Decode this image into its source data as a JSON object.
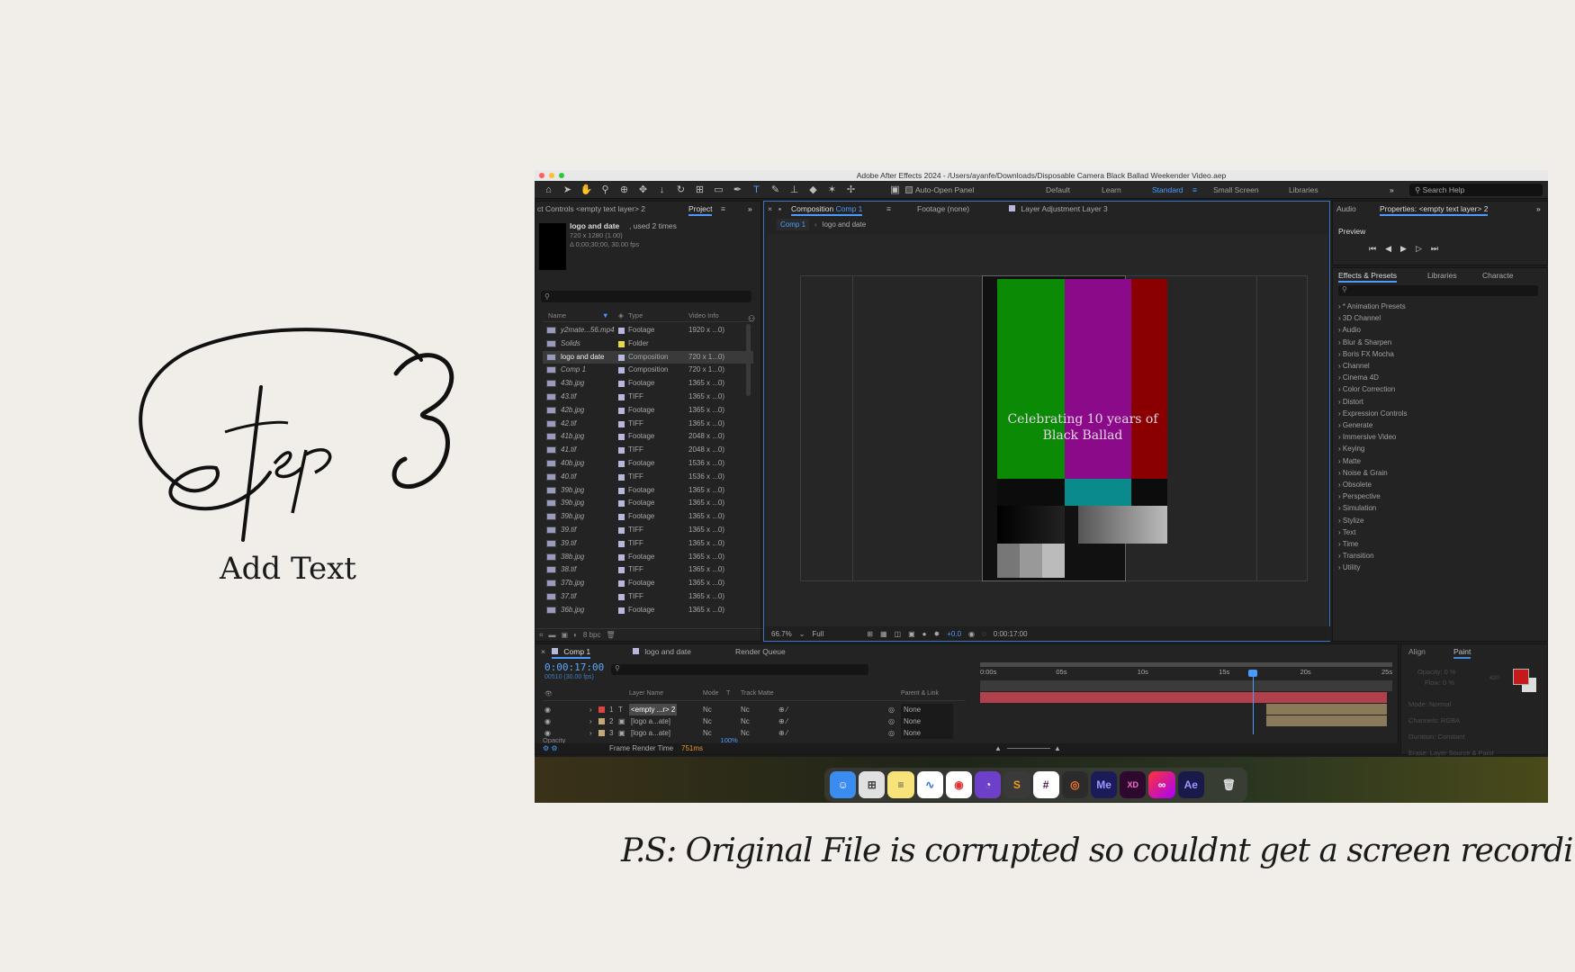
{
  "slide": {
    "step_label": "Step 3",
    "subtitle": "Add Text",
    "ps_note": "P.S: Original File is corrupted so couldnt get a screen recording :("
  },
  "app": {
    "title": "Adobe After Effects 2024 - /Users/ayanfe/Downloads/Disposable Camera Black Ballad Weekender Video.aep",
    "auto_open_panel": "Auto-Open Panel",
    "workspaces": [
      "Default",
      "Learn",
      "Standard",
      "Small Screen",
      "Libraries"
    ],
    "active_workspace": "Standard",
    "search_help": "Search Help",
    "tools": [
      "home-icon",
      "selection-tool-icon",
      "hand-tool-icon",
      "zoom-tool-icon",
      "orbit-icon",
      "pan-icon",
      "dolly-icon",
      "rotate-icon",
      "anchor-icon",
      "rectangle-tool-icon",
      "pen-tool-icon",
      "type-tool-icon",
      "brush-tool-icon",
      "clone-stamp-icon",
      "eraser-icon",
      "roto-brush-icon",
      "puppet-pin-icon"
    ]
  },
  "left_panel": {
    "effects_tab": "ct Controls <empty text layer> 2",
    "project_tab": "Project",
    "item_name": "logo and date",
    "item_used": ", used 2 times",
    "item_size": "720 x 1280 (1.00)",
    "item_duration": "Δ 0;00;30;00, 30.00 fps",
    "columns": [
      "Name",
      "Type",
      "Video Info"
    ],
    "bpc": "8 bpc",
    "items": [
      {
        "name": "y2mate...56.mp4",
        "type": "Footage",
        "info": "1920 x ...0)",
        "label": "#b8b8dc"
      },
      {
        "name": "Solids",
        "type": "Folder",
        "info": "",
        "label": "#e8d84a"
      },
      {
        "name": "logo and date",
        "type": "Composition",
        "info": "720 x 1...0)",
        "label": "#b8b8dc"
      },
      {
        "name": "Comp 1",
        "type": "Composition",
        "info": "720 x 1...0)",
        "label": "#b8b8dc"
      },
      {
        "name": "43b.jpg",
        "type": "Footage",
        "info": "1365 x ...0)",
        "label": "#b8b8dc"
      },
      {
        "name": "43.tif",
        "type": "TIFF",
        "info": "1365 x ...0)",
        "label": "#b8b8dc"
      },
      {
        "name": "42b.jpg",
        "type": "Footage",
        "info": "1365 x ...0)",
        "label": "#b8b8dc"
      },
      {
        "name": "42.tif",
        "type": "TIFF",
        "info": "1365 x ...0)",
        "label": "#b8b8dc"
      },
      {
        "name": "41b.jpg",
        "type": "Footage",
        "info": "2048 x ...0)",
        "label": "#b8b8dc"
      },
      {
        "name": "41.tif",
        "type": "TIFF",
        "info": "2048 x ...0)",
        "label": "#b8b8dc"
      },
      {
        "name": "40b.jpg",
        "type": "Footage",
        "info": "1536 x ...0)",
        "label": "#b8b8dc"
      },
      {
        "name": "40.tif",
        "type": "TIFF",
        "info": "1536 x ...0)",
        "label": "#b8b8dc"
      },
      {
        "name": "39b.jpg",
        "type": "Footage",
        "info": "1365 x ...0)",
        "label": "#b8b8dc"
      },
      {
        "name": "39b.jpg",
        "type": "Footage",
        "info": "1365 x ...0)",
        "label": "#b8b8dc"
      },
      {
        "name": "39b.jpg",
        "type": "Footage",
        "info": "1365 x ...0)",
        "label": "#b8b8dc"
      },
      {
        "name": "39.tif",
        "type": "TIFF",
        "info": "1365 x ...0)",
        "label": "#b8b8dc"
      },
      {
        "name": "39.tif",
        "type": "TIFF",
        "info": "1365 x ...0)",
        "label": "#b8b8dc"
      },
      {
        "name": "38b.jpg",
        "type": "Footage",
        "info": "1365 x ...0)",
        "label": "#b8b8dc"
      },
      {
        "name": "38.tif",
        "type": "TIFF",
        "info": "1365 x ...0)",
        "label": "#b8b8dc"
      },
      {
        "name": "37b.jpg",
        "type": "Footage",
        "info": "1365 x ...0)",
        "label": "#b8b8dc"
      },
      {
        "name": "37.tif",
        "type": "TIFF",
        "info": "1365 x ...0)",
        "label": "#b8b8dc"
      },
      {
        "name": "36b.jpg",
        "type": "Footage",
        "info": "1365 x ...0)",
        "label": "#b8b8dc"
      }
    ]
  },
  "comp_panel": {
    "close": "×",
    "comp_tab_prefix": "Composition",
    "comp_tab_name": "Comp 1",
    "footage_tab": "Footage (none)",
    "layer_tab": "Layer Adjustment Layer 3",
    "crumb1": "Comp 1",
    "crumb2": "logo and date",
    "canvas_text_line1": "Celebrating 10 years of",
    "canvas_text_line2": "Black Ballad",
    "zoom": "66.7%",
    "resolution": "Full",
    "exposure": "+0.0",
    "timecode": "0:00:17:00"
  },
  "right_panel": {
    "audio_tab": "Audio",
    "properties_tab": "Properties: <empty text layer> 2",
    "preview": "Preview",
    "effects_tab": "Effects & Presets",
    "libraries_tab": "Libraries",
    "character_tab": "Characte",
    "categories": [
      "* Animation Presets",
      "3D Channel",
      "Audio",
      "Blur & Sharpen",
      "Boris FX Mocha",
      "Channel",
      "Cinema 4D",
      "Color Correction",
      "Distort",
      "Expression Controls",
      "Generate",
      "Immersive Video",
      "Keying",
      "Matte",
      "Noise & Grain",
      "Obsolete",
      "Perspective",
      "Simulation",
      "Stylize",
      "Text",
      "Time",
      "Transition",
      "Utility"
    ]
  },
  "timeline": {
    "comp_tab": "Comp 1",
    "logo_tab": "logo and date",
    "render_queue": "Render Queue",
    "timecode": "0:00:17:00",
    "frames": "00510 (30.00 fps)",
    "col_layer": "Layer Name",
    "col_mode": "Mode",
    "col_t": "T",
    "col_matte": "Track Matte",
    "col_parent": "Parent & Link",
    "ruler": [
      "0:00s",
      "05s",
      "10s",
      "15s",
      "20s",
      "25s"
    ],
    "layers": [
      {
        "num": "1",
        "name": "<empty ...r> 2",
        "mode": "Nc",
        "matte": "Nc",
        "parent": "None",
        "label": "#d44"
      },
      {
        "num": "2",
        "name": "[logo a...ate]",
        "mode": "Nc",
        "matte": "Nc",
        "parent": "None",
        "label": "#c4a978"
      },
      {
        "num": "3",
        "name": "[logo a...ate]",
        "mode": "Nc",
        "matte": "Nc",
        "parent": "None",
        "label": "#c4a978"
      }
    ],
    "partial_row": "Opacity",
    "partial_value": "100%",
    "frame_render_label": "Frame Render Time",
    "frame_render_value": "751ms"
  },
  "paint_panel": {
    "align_tab": "Align",
    "paint_tab": "Paint",
    "opacity": "Opacity: 0 %",
    "flow": "Flow: 0 %",
    "mode_label": "Mode:",
    "mode_value": "Normal",
    "channels_label": "Channels:",
    "channels_value": "RGBA",
    "duration_label": "Duration:",
    "duration_value": "Constant",
    "erase_label": "Erase:",
    "erase_value": "Layer Source & Paint",
    "brush_size": "420"
  },
  "dock": [
    "Finder",
    "Launchpad",
    "Notes",
    "Freeform",
    "Chrome",
    "GitHub",
    "Sublime",
    "Slack",
    "Blender",
    "Me",
    "XD",
    "Creative Cloud",
    "Ae",
    "Trash"
  ],
  "colors": {
    "accent": "#4b9bff",
    "time_blue": "#5aa8ff",
    "render_orange": "#e59a2d"
  }
}
